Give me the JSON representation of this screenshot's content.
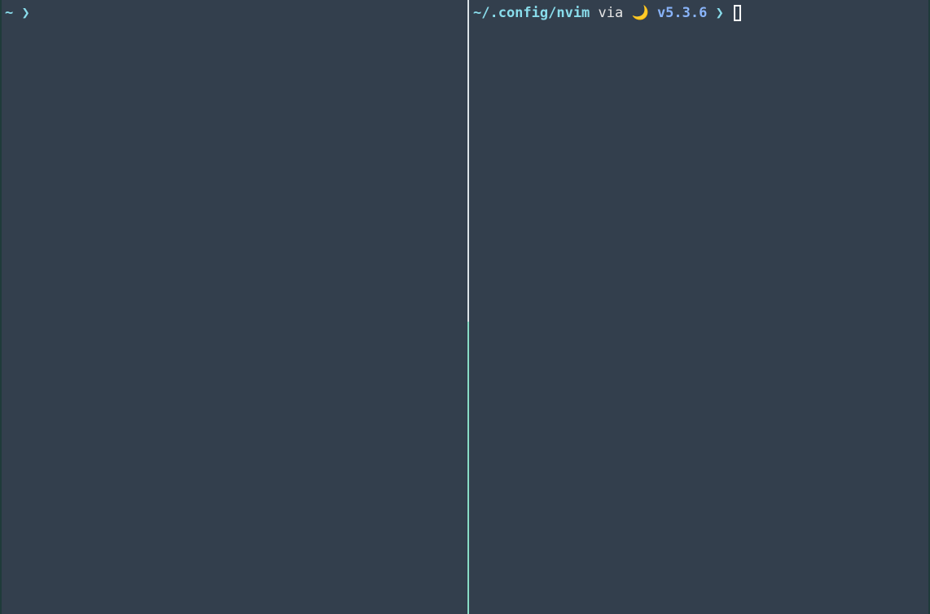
{
  "left_pane": {
    "dir": "~",
    "chevron": "❯"
  },
  "right_pane": {
    "dir": "~/.config/nvim",
    "via": "via",
    "lang_icon": "moon-icon",
    "moon_glyph": "🌙",
    "version": "v5.3.6",
    "chevron": "❯"
  },
  "colors": {
    "background": "#333f4d",
    "dir": "#89dceb",
    "version": "#89b4fa",
    "active_divider": "#89dcc6"
  }
}
